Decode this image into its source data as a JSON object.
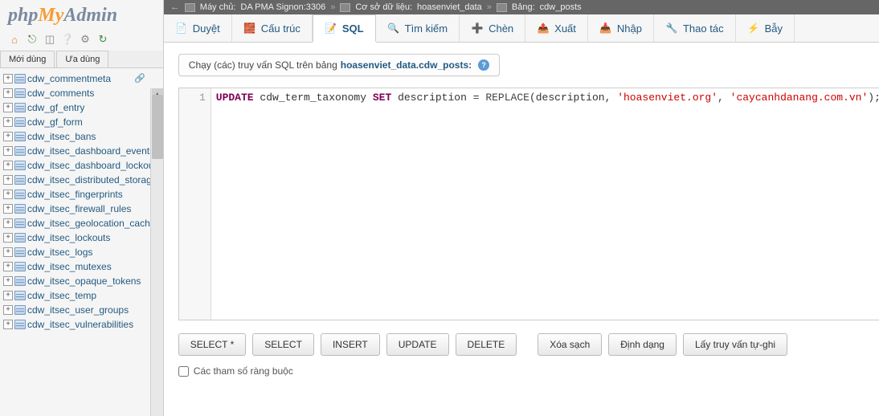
{
  "logo": {
    "php": "php",
    "my": "My",
    "admin": "Admin"
  },
  "sidebar_tabs": {
    "recent": "Mới dùng",
    "favorites": "Ưa dùng"
  },
  "tables": [
    "cdw_commentmeta",
    "cdw_comments",
    "cdw_gf_entry",
    "cdw_gf_form",
    "cdw_itsec_bans",
    "cdw_itsec_dashboard_events",
    "cdw_itsec_dashboard_lockouts",
    "cdw_itsec_distributed_storage",
    "cdw_itsec_fingerprints",
    "cdw_itsec_firewall_rules",
    "cdw_itsec_geolocation_cache",
    "cdw_itsec_lockouts",
    "cdw_itsec_logs",
    "cdw_itsec_mutexes",
    "cdw_itsec_opaque_tokens",
    "cdw_itsec_temp",
    "cdw_itsec_user_groups",
    "cdw_itsec_vulnerabilities"
  ],
  "breadcrumb": {
    "server_label": "Máy chủ:",
    "server_value": "DA PMA Signon:3306",
    "db_label": "Cơ sở dữ liệu:",
    "db_value": "hoasenviet_data",
    "table_label": "Bảng:",
    "table_value": "cdw_posts"
  },
  "maintabs": [
    {
      "label": "Duyệt",
      "icon": "📄"
    },
    {
      "label": "Cấu trúc",
      "icon": "🧱"
    },
    {
      "label": "SQL",
      "icon": "📝"
    },
    {
      "label": "Tìm kiếm",
      "icon": "🔍"
    },
    {
      "label": "Chèn",
      "icon": "➕"
    },
    {
      "label": "Xuất",
      "icon": "📤"
    },
    {
      "label": "Nhập",
      "icon": "📥"
    },
    {
      "label": "Thao tác",
      "icon": "🔧"
    },
    {
      "label": "Bẫy",
      "icon": "⚡"
    }
  ],
  "active_tab_index": 2,
  "sql_title": {
    "prefix": "Chạy (các) truy vấn SQL trên bảng",
    "target": "hoasenviet_data.cdw_posts:"
  },
  "sql_query": {
    "line": "1",
    "tokens": [
      {
        "t": "kw",
        "v": "UPDATE"
      },
      {
        "t": "sp",
        "v": " "
      },
      {
        "t": "ident",
        "v": "cdw_term_taxonomy"
      },
      {
        "t": "sp",
        "v": " "
      },
      {
        "t": "kw",
        "v": "SET"
      },
      {
        "t": "sp",
        "v": " "
      },
      {
        "t": "ident",
        "v": "description"
      },
      {
        "t": "sp",
        "v": " "
      },
      {
        "t": "op",
        "v": "="
      },
      {
        "t": "sp",
        "v": " "
      },
      {
        "t": "fn",
        "v": "REPLACE"
      },
      {
        "t": "op",
        "v": "("
      },
      {
        "t": "ident",
        "v": "description"
      },
      {
        "t": "op",
        "v": ","
      },
      {
        "t": "sp",
        "v": " "
      },
      {
        "t": "str",
        "v": "'hoasenviet.org'"
      },
      {
        "t": "op",
        "v": ","
      },
      {
        "t": "sp",
        "v": " "
      },
      {
        "t": "str",
        "v": "'caycanhdanang.com.vn'"
      },
      {
        "t": "op",
        "v": ");"
      }
    ]
  },
  "buttons": {
    "select_star": "SELECT *",
    "select": "SELECT",
    "insert": "INSERT",
    "update": "UPDATE",
    "delete": "DELETE",
    "clear": "Xóa sạch",
    "format": "Định dạng",
    "autosave": "Lấy truy vấn tự-ghi"
  },
  "checkbox_label": "Các tham số ràng buộc"
}
